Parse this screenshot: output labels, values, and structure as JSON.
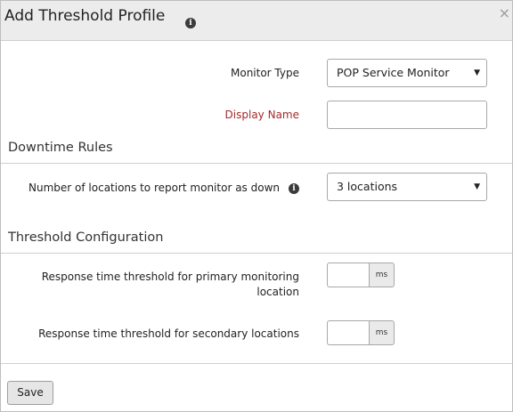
{
  "dialog": {
    "title": "Add Threshold Profile",
    "close_glyph": "×"
  },
  "info_icon_glyph": "i",
  "monitor_type": {
    "label": "Monitor Type",
    "value": "POP Service Monitor",
    "caret": "▼"
  },
  "display_name": {
    "label": "Display Name",
    "value": ""
  },
  "downtime_rules": {
    "title": "Downtime Rules",
    "locations_label": "Number of locations to report monitor as down",
    "locations_value": "3 locations",
    "caret": "▼"
  },
  "threshold_configuration": {
    "title": "Threshold Configuration",
    "primary_label_line1": "Response time threshold for primary monitoring",
    "primary_label_line2": "location",
    "primary_value": "",
    "primary_unit": "ms",
    "secondary_label": "Response time threshold for secondary locations",
    "secondary_value": "",
    "secondary_unit": "ms"
  },
  "footer": {
    "save_label": "Save"
  },
  "colors": {
    "header_bg": "#ececec",
    "required_label": "#a52a2a",
    "info_icon_bg": "#3b3b3b"
  }
}
